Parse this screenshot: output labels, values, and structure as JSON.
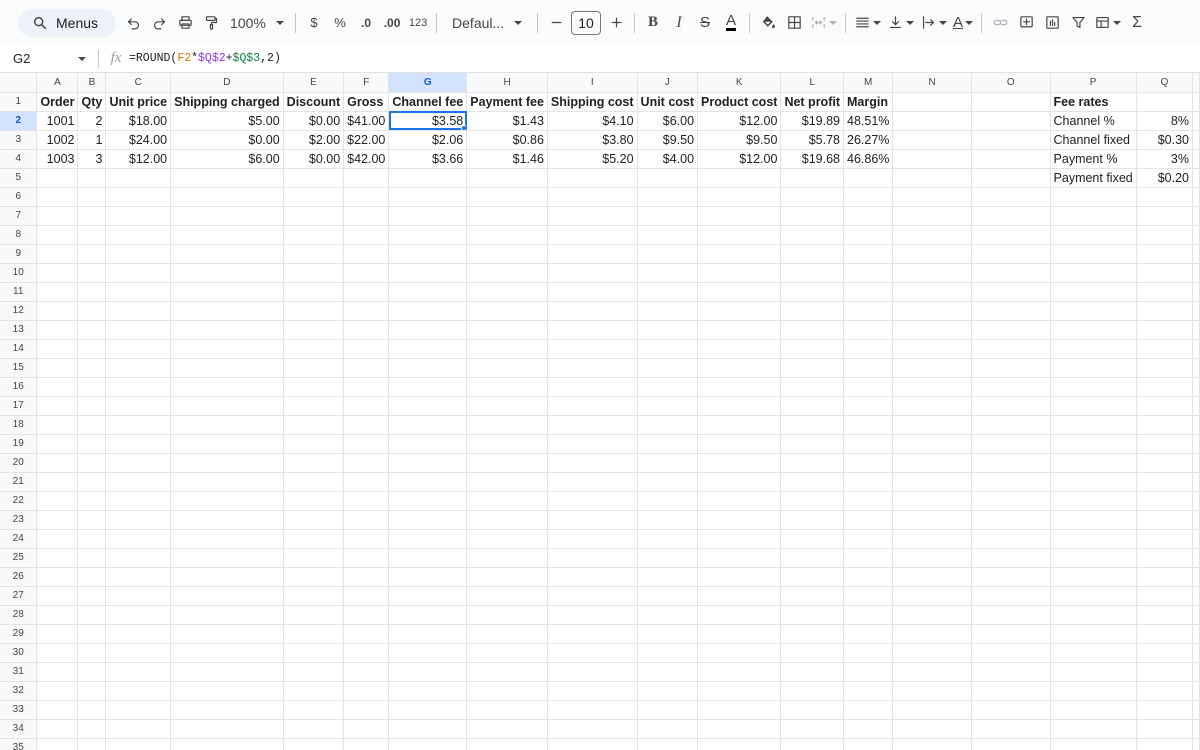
{
  "toolbar": {
    "menus_label": "Menus",
    "zoom": "100%",
    "currency_symbol": "$",
    "percent_symbol": "%",
    "decrease_decimal": ".0",
    "increase_decimal": ".00",
    "number_format": "123",
    "font_name": "Defaul...",
    "font_size": "10",
    "bold": "B",
    "italic": "I",
    "strikethrough": "S",
    "text_color": "A",
    "text_color_2": "A",
    "sum": "Σ"
  },
  "formula_bar": {
    "cell_ref": "G2",
    "fx": "fx",
    "formula_parts": [
      "=ROUND(",
      "F2",
      "*",
      "$Q$2",
      "+",
      "$Q$3",
      ",2)"
    ]
  },
  "selection": {
    "column": "G",
    "row": "2"
  },
  "columns": [
    "A",
    "B",
    "C",
    "D",
    "E",
    "F",
    "G",
    "H",
    "I",
    "J",
    "K",
    "L",
    "M",
    "N",
    "O",
    "P",
    "Q"
  ],
  "rows": [
    [
      "Order",
      "Qty",
      "Unit price",
      "Shipping charged",
      "Discount",
      "Gross",
      "Channel fee",
      "Payment fee",
      "Shipping cost",
      "Unit cost",
      "Product cost",
      "Net profit",
      "Margin",
      "",
      "",
      "Fee rates",
      ""
    ],
    [
      "1001",
      "2",
      "$18.00",
      "$5.00",
      "$0.00",
      "$41.00",
      "$3.58",
      "$1.43",
      "$4.10",
      "$6.00",
      "$12.00",
      "$19.89",
      "48.51%",
      "",
      "",
      "Channel %",
      "8%"
    ],
    [
      "1002",
      "1",
      "$24.00",
      "$0.00",
      "$2.00",
      "$22.00",
      "$2.06",
      "$0.86",
      "$3.80",
      "$9.50",
      "$9.50",
      "$5.78",
      "26.27%",
      "",
      "",
      "Channel fixed",
      "$0.30"
    ],
    [
      "1003",
      "3",
      "$12.00",
      "$6.00",
      "$0.00",
      "$42.00",
      "$3.66",
      "$1.46",
      "$5.20",
      "$4.00",
      "$12.00",
      "$19.68",
      "46.86%",
      "",
      "",
      "Payment %",
      "3%"
    ],
    [
      "",
      "",
      "",
      "",
      "",
      "",
      "",
      "",
      "",
      "",
      "",
      "",
      "",
      "",
      "",
      "Payment fixed",
      "$0.20"
    ]
  ],
  "row_count": 35
}
